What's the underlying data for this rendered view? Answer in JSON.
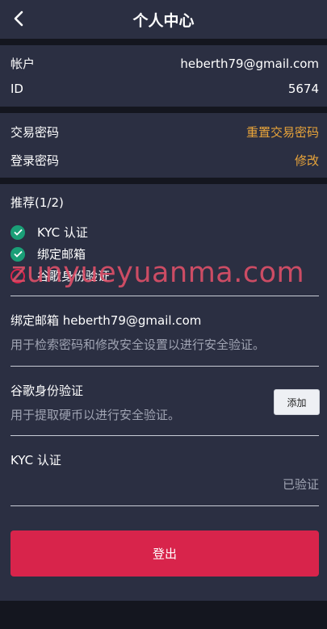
{
  "header": {
    "title": "个人中心"
  },
  "account": {
    "account_label": "帐户",
    "account_value": "heberth79@gmail.com",
    "id_label": "ID",
    "id_value": "5674"
  },
  "passwords": {
    "trade_label": "交易密码",
    "trade_action": "重置交易密码",
    "login_label": "登录密码",
    "login_action": "修改"
  },
  "recommend": {
    "title": "推荐(1/2)",
    "items": [
      {
        "label": "KYC 认证",
        "done": true
      },
      {
        "label": "绑定邮箱",
        "done": true
      },
      {
        "label": "谷歌身份验证",
        "done": false
      }
    ]
  },
  "watermark": "zunyueyuanma.com",
  "email_card": {
    "title": "绑定邮箱 heberth79@gmail.com",
    "desc": "用于检索密码和修改安全设置以进行安全验证。"
  },
  "google_card": {
    "title": "谷歌身份验证",
    "desc": "用于提取硬币以进行安全验证。",
    "button": "添加"
  },
  "kyc_card": {
    "title": "KYC 认证",
    "status": "已验证"
  },
  "logout": {
    "label": "登出"
  },
  "colors": {
    "accent": "#d8244b",
    "link": "#e8a43a",
    "check": "#1a9f77",
    "panel": "#2b2f42"
  }
}
